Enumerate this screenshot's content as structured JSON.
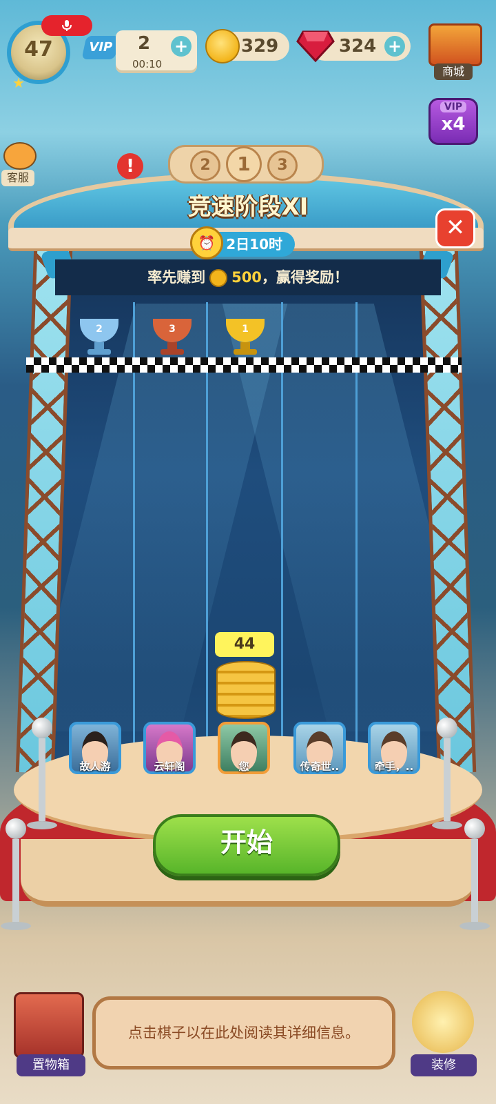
{
  "hud": {
    "level": "47",
    "vip_label": "VIP",
    "vip_count": "2",
    "vip_timer": "00:10",
    "coins": "329",
    "gems": "324",
    "plus": "+",
    "shop_label": "商城",
    "vip_multiplier_top": "VIP",
    "vip_multiplier": "x4",
    "service_label": "客服"
  },
  "race": {
    "podium_numbers": [
      "2",
      "1",
      "3"
    ],
    "title": "竞速阶段XI",
    "time_left": "2日10时",
    "goal_prefix": "率先赚到",
    "goal_amount": "500",
    "goal_suffix": "，赢得奖励！",
    "trophies": [
      {
        "rank": "2",
        "color": "#8ec6ef"
      },
      {
        "rank": "3",
        "color": "#d9643a"
      },
      {
        "rank": "1",
        "color": "#f3c226"
      }
    ],
    "my_score": "44",
    "players": [
      {
        "name": "故人游"
      },
      {
        "name": "云轩阁"
      },
      {
        "name": "您"
      },
      {
        "name": "传奇世.."
      },
      {
        "name": "牵手，.."
      }
    ],
    "start_label": "开始",
    "close_symbol": "✕"
  },
  "bottom": {
    "info_text": "点击棋子以在此处阅读其详细信息。",
    "storage_label": "置物箱",
    "decorate_label": "装修"
  },
  "colors": {
    "accent_green": "#58b52a",
    "close_red": "#e8412f",
    "score_yellow": "#fff45c"
  }
}
